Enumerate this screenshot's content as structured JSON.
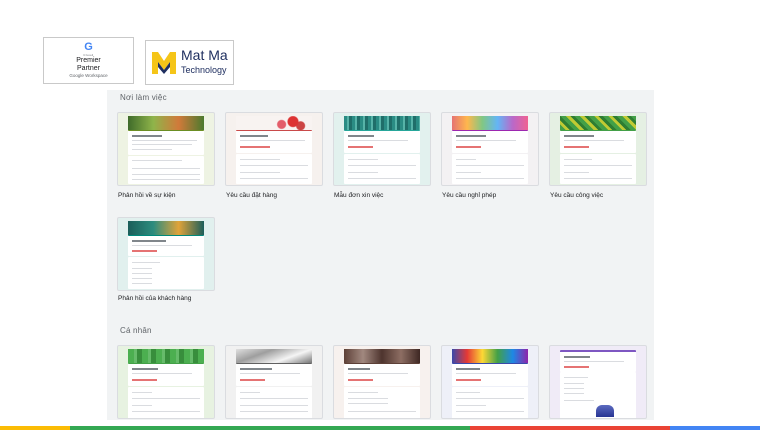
{
  "partner_badge": {
    "g_letter": "G",
    "line1": "Cloud",
    "line2": "Premier",
    "line3": "Partner",
    "line4": "Google Workspace"
  },
  "brand_logo": {
    "title": "Mat Ma",
    "subtitle": "Technology",
    "colors": {
      "yellow": "#f5c518",
      "navy": "#1f2f60"
    }
  },
  "gallery": {
    "sections": [
      {
        "title": "Nơi làm việc",
        "templates": [
          {
            "label": "Phản hồi về sự kiện",
            "bg": "#eef3e3",
            "icon": "event-feedback-thumbnail"
          },
          {
            "label": "Yêu cầu đặt hàng",
            "bg": "#f6f1ee",
            "icon": "order-request-thumbnail"
          },
          {
            "label": "Mẫu đơn xin việc",
            "bg": "#e2f1ee",
            "icon": "job-application-thumbnail"
          },
          {
            "label": "Yêu cầu nghỉ phép",
            "bg": "#f3f1f3",
            "icon": "time-off-request-thumbnail"
          },
          {
            "label": "Yêu cầu công việc",
            "bg": "#e5f0e3",
            "icon": "work-request-thumbnail"
          },
          {
            "label": "Phản hồi của khách hàng",
            "bg": "#e1f0ee",
            "icon": "customer-feedback-thumbnail"
          }
        ]
      },
      {
        "title": "Cá nhân",
        "templates": [
          {
            "label": "",
            "bg": "#e7f2e1",
            "icon": "contact-info-thumbnail"
          },
          {
            "label": "",
            "bg": "#f1f1f1",
            "icon": "party-invite-thumbnail"
          },
          {
            "label": "",
            "bg": "#f7f1ee",
            "icon": "rsvp-thumbnail"
          },
          {
            "label": "",
            "bg": "#eef0f8",
            "icon": "tshirt-signup-thumbnail"
          },
          {
            "label": "",
            "bg": "#f0ebf7",
            "icon": "event-registration-thumbnail"
          }
        ]
      }
    ]
  },
  "brand_bar_colors": [
    "#fbbc04",
    "#34a853",
    "#ea4335",
    "#4285f4"
  ]
}
